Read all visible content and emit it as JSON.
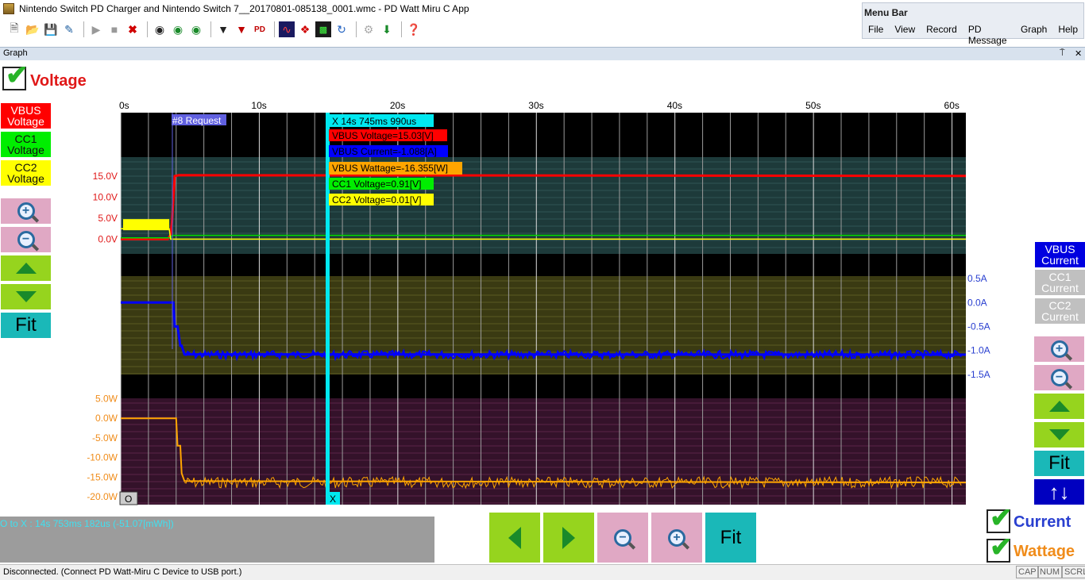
{
  "window": {
    "title": "Nintendo Switch PD Charger and Nintendo Switch 7__20170801-085138_0001.wmc - PD Watt Miru C App"
  },
  "menubar": {
    "title": "Menu Bar",
    "items": [
      "File",
      "View",
      "Record",
      "PD Message",
      "Graph",
      "Help"
    ]
  },
  "toolbar": {
    "icons": [
      "new-icon",
      "open-icon",
      "save-icon",
      "export-icon",
      "play-icon",
      "stop-icon",
      "delete-icon",
      "find-icon",
      "find-next-icon",
      "find-prev-icon",
      "filter-icon",
      "filter-clear-icon",
      "pd-icon",
      "wave-icon",
      "marker-icon",
      "graph-icon",
      "refresh-icon",
      "settings-icon",
      "download-icon",
      "help-icon"
    ]
  },
  "graph_panel": {
    "label": "Graph",
    "pin_glyph": "⍑",
    "close_glyph": "✕"
  },
  "left_panel": {
    "voltage_check_label": "Voltage",
    "vbus_voltage_label": [
      "VBUS",
      "Voltage"
    ],
    "cc1_voltage_label": [
      "CC1",
      "Voltage"
    ],
    "cc2_voltage_label": [
      "CC2",
      "Voltage"
    ],
    "fit_label": "Fit"
  },
  "right_panel": {
    "vbus_current_label": [
      "VBUS",
      "Current"
    ],
    "cc1_current_label": [
      "CC1",
      "Current"
    ],
    "cc2_current_label": [
      "CC2",
      "Current"
    ],
    "fit_label": "Fit",
    "swap_glyph": "↑↓",
    "current_check_label": "Current",
    "wattage_check_label": "Wattage"
  },
  "cursor_readout": {
    "header": "X   14s 745ms 990us",
    "vbus_voltage": "VBUS Voltage=15.03[V]",
    "vbus_current": "VBUS Current=-1.088[A]",
    "vbus_wattage": "VBUS Wattage=-16.355[W]",
    "cc1_voltage": "CC1 Voltage=0.91[V]",
    "cc2_voltage": "CC2 Voltage=0.01[V]"
  },
  "markers": {
    "request_label": "#8 Request",
    "origin_label": "O",
    "cursor_label": "X"
  },
  "info": {
    "o_to_x": "O to X :  14s 753ms 182us (-51.07[mWh])"
  },
  "bottom_buttons": {
    "fit_label": "Fit"
  },
  "status": {
    "message": "Disconnected.  (Connect PD Watt-Miru C Device to USB port.)",
    "indicators": [
      "CAP",
      "NUM",
      "SCRL"
    ]
  },
  "colors": {
    "vbus_voltage": "#ff0000",
    "cc1_voltage": "#00dd00",
    "cc2_voltage": "#ffff00",
    "vbus_current": "#0000ff",
    "wattage": "#ffa500",
    "cursor": "#00e8f0"
  },
  "chart_data": [
    {
      "type": "line",
      "title": "",
      "x_tick_labels": [
        "0s",
        "10s",
        "20s",
        "30s",
        "40s",
        "50s",
        "60s"
      ],
      "x_ticks": [
        0,
        10,
        20,
        30,
        40,
        50,
        60
      ],
      "xlim": [
        0,
        61
      ],
      "y_tick_labels": [
        "15.0V",
        "10.0V",
        "5.0V",
        "0.0V"
      ],
      "y_ticks": [
        15,
        10,
        5,
        0
      ],
      "ylim": [
        -3.5,
        19.5
      ],
      "series": [
        {
          "name": "VBUS Voltage",
          "x": [
            0,
            3.4,
            3.6,
            3.7,
            3.9,
            4.2,
            61
          ],
          "y": [
            0,
            0,
            1,
            4,
            15.0,
            15.2,
            15.03
          ]
        },
        {
          "name": "CC1 Voltage",
          "x": [
            0,
            3.6,
            3.7,
            61
          ],
          "y": [
            0.3,
            0.3,
            0.91,
            0.91
          ]
        },
        {
          "name": "CC2 Voltage",
          "x": [
            0,
            3.5,
            3.6,
            61
          ],
          "y": [
            2.5,
            2.5,
            0.01,
            0.01
          ]
        }
      ]
    },
    {
      "type": "line",
      "title": "",
      "y_tick_labels": [
        "-1.5A",
        "-1.0A",
        "-0.5A",
        "0.0A",
        "0.5A"
      ],
      "y_ticks": [
        -1.5,
        -1.0,
        -0.5,
        0.0,
        0.5
      ],
      "ylim": [
        -1.6,
        0.55
      ],
      "xlim": [
        0,
        61
      ],
      "series": [
        {
          "name": "VBUS Current",
          "x": [
            0,
            3.8,
            3.9,
            4.1,
            4.3,
            4.4,
            4.6,
            61
          ],
          "y": [
            0,
            0,
            -0.5,
            -0.5,
            -0.9,
            -0.9,
            -1.08,
            -1.088
          ]
        }
      ]
    },
    {
      "type": "line",
      "title": "",
      "y_tick_labels": [
        "-20.0W",
        "-15.0W",
        "-10.0W",
        "-5.0W",
        "0.0W",
        "5.0W"
      ],
      "y_ticks": [
        -20,
        -15,
        -10,
        -5,
        0,
        5
      ],
      "ylim": [
        -22,
        5.5
      ],
      "xlim": [
        0,
        61
      ],
      "series": [
        {
          "name": "VBUS Wattage",
          "x": [
            0,
            4.0,
            4.1,
            4.3,
            4.4,
            4.6,
            61
          ],
          "y": [
            0,
            0,
            -7,
            -7,
            -14,
            -16,
            -16.355
          ]
        }
      ]
    }
  ]
}
